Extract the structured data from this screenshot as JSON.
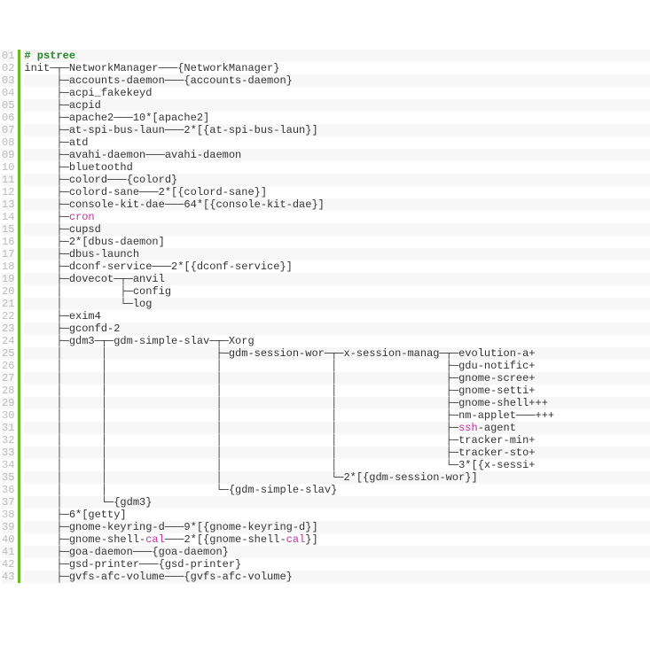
{
  "command": "# pstree",
  "lines": [
    {
      "n": "01",
      "text": "# pstree",
      "hl": [
        {
          "t": "cmd",
          "s": "# pstree"
        }
      ]
    },
    {
      "n": "02",
      "text": "init─┬─NetworkManager───{NetworkManager}"
    },
    {
      "n": "03",
      "text": "     ├─accounts-daemon───{accounts-daemon}"
    },
    {
      "n": "04",
      "text": "     ├─acpi_fakekeyd"
    },
    {
      "n": "05",
      "text": "     ├─acpid"
    },
    {
      "n": "06",
      "text": "     ├─apache2───10*[apache2]"
    },
    {
      "n": "07",
      "text": "     ├─at-spi-bus-laun───2*[{at-spi-bus-laun}]"
    },
    {
      "n": "08",
      "text": "     ├─atd"
    },
    {
      "n": "09",
      "text": "     ├─avahi-daemon───avahi-daemon"
    },
    {
      "n": "10",
      "text": "     ├─bluetoothd"
    },
    {
      "n": "11",
      "text": "     ├─colord───{colord}"
    },
    {
      "n": "12",
      "text": "     ├─colord-sane───2*[{colord-sane}]"
    },
    {
      "n": "13",
      "text": "     ├─console-kit-dae───64*[{console-kit-dae}]"
    },
    {
      "n": "14",
      "text": "     ├─cron",
      "hl": [
        {
          "t": "pink",
          "s": "cron"
        }
      ]
    },
    {
      "n": "15",
      "text": "     ├─cupsd"
    },
    {
      "n": "16",
      "text": "     ├─2*[dbus-daemon]"
    },
    {
      "n": "17",
      "text": "     ├─dbus-launch"
    },
    {
      "n": "18",
      "text": "     ├─dconf-service───2*[{dconf-service}]"
    },
    {
      "n": "19",
      "text": "     ├─dovecot─┬─anvil"
    },
    {
      "n": "20",
      "text": "     │         ├─config"
    },
    {
      "n": "21",
      "text": "     │         └─log"
    },
    {
      "n": "22",
      "text": "     ├─exim4"
    },
    {
      "n": "23",
      "text": "     ├─gconfd-2"
    },
    {
      "n": "24",
      "text": "     ├─gdm3─┬─gdm-simple-slav─┬─Xorg"
    },
    {
      "n": "25",
      "text": "     │      │                 ├─gdm-session-wor─┬─x-session-manag─┬─evolution-a+"
    },
    {
      "n": "26",
      "text": "     │      │                 │                 │                 ├─gdu-notific+"
    },
    {
      "n": "27",
      "text": "     │      │                 │                 │                 ├─gnome-scree+"
    },
    {
      "n": "28",
      "text": "     │      │                 │                 │                 ├─gnome-setti+"
    },
    {
      "n": "29",
      "text": "     │      │                 │                 │                 ├─gnome-shell+++"
    },
    {
      "n": "30",
      "text": "     │      │                 │                 │                 ├─nm-applet───+++"
    },
    {
      "n": "31",
      "text": "     │      │                 │                 │                 ├─ssh-agent",
      "hl": [
        {
          "t": "pink",
          "s": "ssh"
        }
      ]
    },
    {
      "n": "32",
      "text": "     │      │                 │                 │                 ├─tracker-min+"
    },
    {
      "n": "33",
      "text": "     │      │                 │                 │                 ├─tracker-sto+"
    },
    {
      "n": "34",
      "text": "     │      │                 │                 │                 └─3*[{x-sessi+"
    },
    {
      "n": "35",
      "text": "     │      │                 │                 └─2*[{gdm-session-wor}]"
    },
    {
      "n": "36",
      "text": "     │      │                 └─{gdm-simple-slav}"
    },
    {
      "n": "37",
      "text": "     │      └─{gdm3}"
    },
    {
      "n": "38",
      "text": "     ├─6*[getty]"
    },
    {
      "n": "39",
      "text": "     ├─gnome-keyring-d───9*[{gnome-keyring-d}]"
    },
    {
      "n": "40",
      "text": "     ├─gnome-shell-cal───2*[{gnome-shell-cal}]",
      "hl": [
        {
          "t": "pink",
          "s": "cal"
        }
      ]
    },
    {
      "n": "41",
      "text": "     ├─goa-daemon───{goa-daemon}"
    },
    {
      "n": "42",
      "text": "     ├─gsd-printer───{gsd-printer}"
    },
    {
      "n": "43",
      "text": "     ├─gvfs-afc-volume───{gvfs-afc-volume}"
    }
  ]
}
